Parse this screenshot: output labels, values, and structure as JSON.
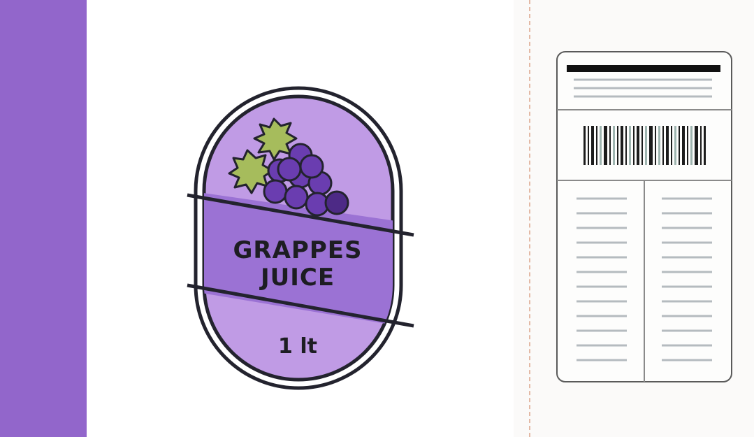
{
  "label": {
    "title_line1": "GRAPPES",
    "title_line2": "JUICE",
    "volume": "1 lt"
  },
  "colors": {
    "stripe": "#9266cb",
    "label_fill": "#c09be5",
    "band_fill": "#9b72d4",
    "outline": "#23232e",
    "grape": "#6a3db0",
    "grape_dark": "#4d2a86",
    "leaf": "#a6bc5c"
  },
  "icons": [
    "grape-bunch-icon",
    "grape-leaf-icon",
    "barcode-icon"
  ]
}
